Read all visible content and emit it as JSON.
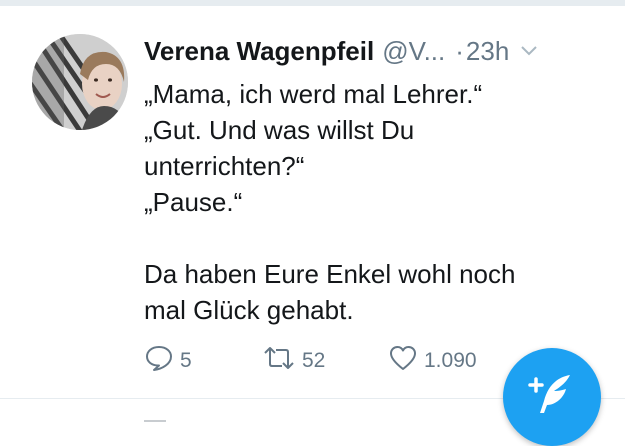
{
  "tweet": {
    "author": {
      "display_name": "Verena Wagenpfeil",
      "handle": "@V...",
      "avatar_icon": "user-photo-avatar"
    },
    "time_separator": "·",
    "timestamp": "23h",
    "menu_icon": "chevron-down-icon",
    "text_lines": [
      "„Mama, ich werd mal Lehrer.“",
      "„Gut. Und was willst Du",
      "unterrichten?“",
      "„Pause.“"
    ],
    "text_lines_2": [
      "Da haben Eure Enkel wohl noch",
      "mal Glück gehabt."
    ],
    "actions": {
      "reply_count": "5",
      "retweet_count": "52",
      "like_count": "1.090"
    }
  },
  "compose_button": {
    "icon": "compose-feather-icon"
  },
  "colors": {
    "accent": "#1da1f2",
    "text": "#14171a",
    "muted": "#657786",
    "divider": "#e6ecf0"
  }
}
